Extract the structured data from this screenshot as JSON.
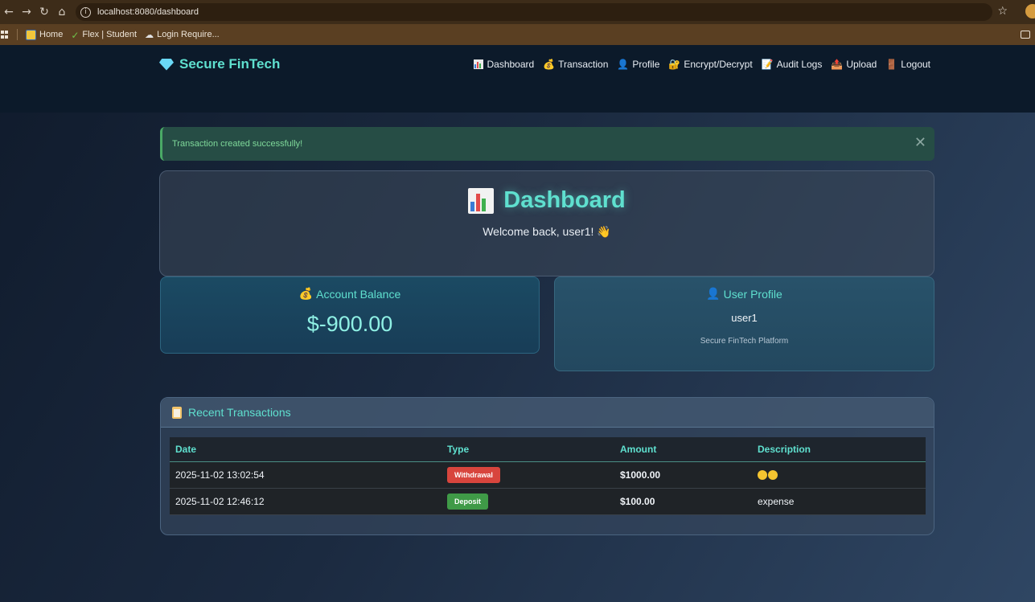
{
  "browser": {
    "url": "localhost:8080/dashboard",
    "bookmarks": [
      {
        "label": "Home"
      },
      {
        "label": "Flex | Student"
      },
      {
        "label": "Login Require..."
      }
    ]
  },
  "brand": {
    "name": "Secure FinTech"
  },
  "nav": {
    "items": [
      {
        "label": "Dashboard"
      },
      {
        "label": "Transaction"
      },
      {
        "label": "Profile"
      },
      {
        "label": "Encrypt/Decrypt"
      },
      {
        "label": "Audit Logs"
      },
      {
        "label": "Upload"
      },
      {
        "label": "Logout"
      }
    ]
  },
  "alert": {
    "message": "Transaction created successfully!",
    "close_label": "✕"
  },
  "dashboard": {
    "title": "Dashboard",
    "welcome": "Welcome back, user1! 👋"
  },
  "balance": {
    "heading": "Account Balance",
    "value": "$-900.00"
  },
  "profile": {
    "heading": "User Profile",
    "username": "user1",
    "platform": "Secure FinTech Platform"
  },
  "transactions": {
    "heading": "Recent Transactions",
    "columns": [
      "Date",
      "Type",
      "Amount",
      "Description"
    ],
    "rows": [
      {
        "date": "2025-11-02 13:02:54",
        "type": "Withdrawal",
        "amount": "$1000.00",
        "description": ""
      },
      {
        "date": "2025-11-02 12:46:12",
        "type": "Deposit",
        "amount": "$100.00",
        "description": "expense"
      }
    ]
  },
  "colors": {
    "accent": "#5fe0cf",
    "withdrawal": "#d8453d",
    "deposit": "#3f9a47"
  }
}
